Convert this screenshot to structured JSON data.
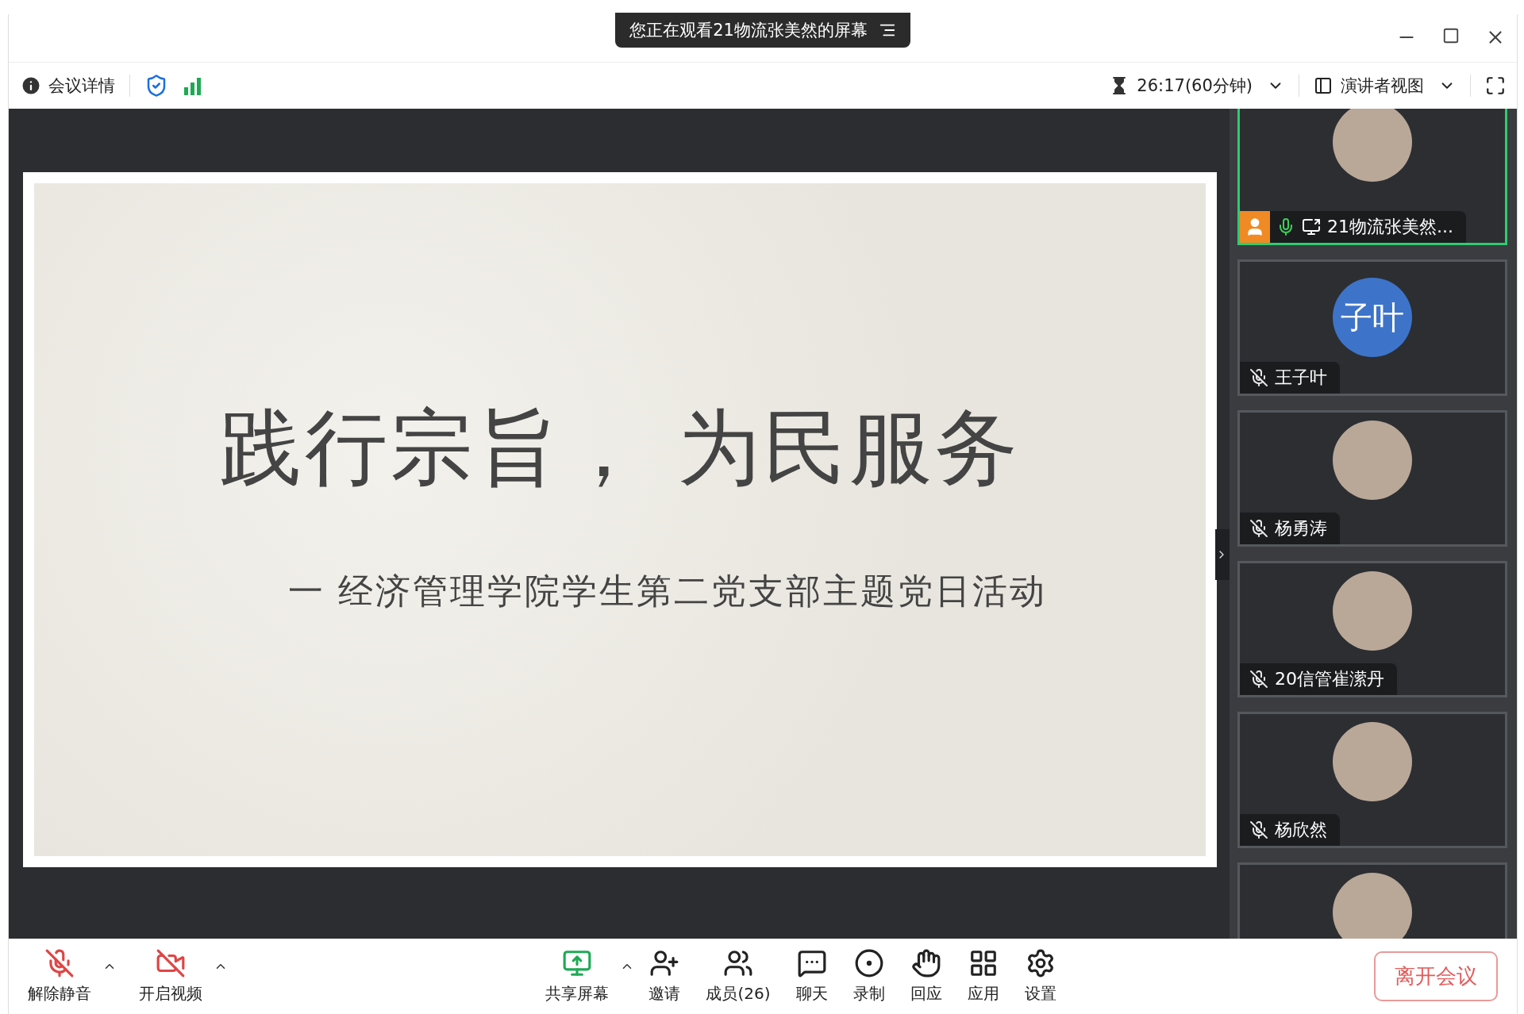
{
  "banner": {
    "text": "您正在观看21物流张美然的屏幕"
  },
  "toolbar": {
    "meeting_info": "会议详情",
    "timer": "26:17(60分钟)",
    "view": "演讲者视图"
  },
  "slide": {
    "title": "践行宗旨， 为民服务",
    "subtitle": "一 经济管理学院学生第二党支部主题党日活动"
  },
  "participants": [
    {
      "name": "21物流张美然...",
      "kind": "photo",
      "selected": true,
      "host": true,
      "muted": false,
      "sharing": true
    },
    {
      "name": "王子叶",
      "kind": "initials",
      "initials": "子叶",
      "selected": false,
      "host": false,
      "muted": true,
      "sharing": false
    },
    {
      "name": "杨勇涛",
      "kind": "photo",
      "selected": false,
      "host": false,
      "muted": true,
      "sharing": false
    },
    {
      "name": "20信管崔潆丹",
      "kind": "photo",
      "selected": false,
      "host": false,
      "muted": true,
      "sharing": false
    },
    {
      "name": "杨欣然",
      "kind": "photo",
      "selected": false,
      "host": false,
      "muted": true,
      "sharing": false
    },
    {
      "kind": "photo",
      "selected": false
    }
  ],
  "controls": [
    {
      "kind": "mic-off",
      "label": "解除静音",
      "caret": true
    },
    {
      "kind": "video-off",
      "label": "开启视频",
      "caret": true
    },
    {
      "kind": "share",
      "label": "共享屏幕",
      "caret": true
    },
    {
      "kind": "invite",
      "label": "邀请",
      "caret": false
    },
    {
      "kind": "members",
      "label": "成员(26)",
      "caret": false
    },
    {
      "kind": "chat",
      "label": "聊天",
      "caret": false
    },
    {
      "kind": "record",
      "label": "录制",
      "caret": false
    },
    {
      "kind": "react",
      "label": "回应",
      "caret": false
    },
    {
      "kind": "apps",
      "label": "应用",
      "caret": false
    },
    {
      "kind": "settings",
      "label": "设置",
      "caret": false
    }
  ],
  "leave_button": "离开会议"
}
